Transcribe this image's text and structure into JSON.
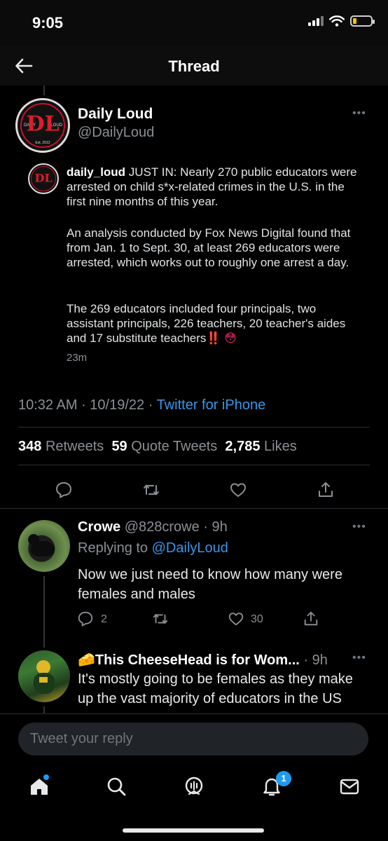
{
  "status_bar": {
    "time": "9:05"
  },
  "nav": {
    "title": "Thread"
  },
  "tweet": {
    "author_name": "Daily Loud",
    "author_handle": "@DailyLoud",
    "quoted_username": "daily_loud",
    "paragraph_1_rest": " JUST IN: Nearly 270 public educators were arrested on child s*x-related crimes in the U.S. in the first nine months of this year.",
    "paragraph_2": "An analysis conducted by Fox News Digital found that from Jan. 1 to Sept. 30, at least 269 educators were arrested, which works out to roughly one arrest a day.",
    "paragraph_3": "The 269 educators included four principals, two assistant principals, 226 teachers, 20 teacher's aides and 17 substitute teachers",
    "paragraph_3_emoji": "‼️ 😳",
    "quoted_time_ago": "23m",
    "time": "10:32 AM",
    "date": "10/19/22",
    "source": "Twitter for iPhone",
    "retweets_count": "348",
    "retweets_label": "Retweets",
    "quotes_count": "59",
    "quotes_label": "Quote Tweets",
    "likes_count": "2,785",
    "likes_label": "Likes"
  },
  "avatar_text": {
    "initials": "DL",
    "left": "DAILY",
    "right": "LOUD",
    "est": "Est. 2012"
  },
  "replies": [
    {
      "name": "Crowe",
      "handle": "@828crowe",
      "time": "9h",
      "replying_prefix": "Replying to",
      "replying_to": "@DailyLoud",
      "text": "Now we just need to know how many were females and males",
      "reply_count": "2",
      "like_count": "30"
    },
    {
      "name": "🧀This CheeseHead is for Wom...",
      "time": "9h",
      "text": "It's mostly going to be females as they make up the vast majority of educators in the US"
    }
  ],
  "compose": {
    "placeholder": "Tweet your reply"
  },
  "tabbar": {
    "notifications_badge": "1"
  },
  "icons": {
    "back": "arrow-left-icon",
    "more": "more-horizontal-icon",
    "reply": "comment-icon",
    "retweet": "retweet-icon",
    "like": "heart-icon",
    "share": "share-icon",
    "home": "home-icon",
    "search": "search-icon",
    "spaces": "spaces-icon",
    "notifications": "bell-icon",
    "messages": "mail-icon"
  },
  "colors": {
    "accent": "#1d9bf0",
    "link": "#3a95e8",
    "brand_red": "#e11b2c"
  }
}
